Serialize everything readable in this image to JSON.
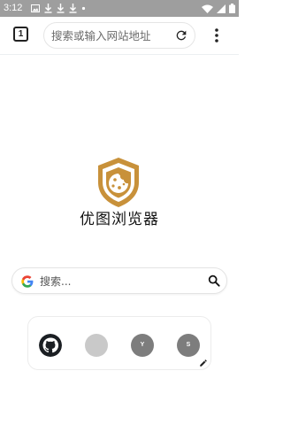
{
  "status_bar": {
    "time": "3:12",
    "left_icons": [
      "image-icon",
      "download-icon",
      "download-icon",
      "download-icon",
      "dot-icon"
    ],
    "right_icons": [
      "wifi-icon",
      "signal-icon",
      "battery-icon"
    ]
  },
  "toolbar": {
    "tab_count": "1",
    "address_placeholder": "搜索或输入网站地址",
    "reload_icon": "reload-icon",
    "menu_icon": "more-vert-icon"
  },
  "brand": {
    "app_name": "优图浏览器",
    "logo_icon": "shield-cookie-icon",
    "logo_color": "#c8913a"
  },
  "search": {
    "placeholder": "搜索...",
    "engine_icon": "google-g-icon",
    "search_icon": "search-icon"
  },
  "shortcuts": {
    "tiles": [
      {
        "icon": "github-icon",
        "letter": ""
      },
      {
        "icon": "blank-tile",
        "letter": ""
      },
      {
        "icon": "letter-tile",
        "letter": "Y"
      },
      {
        "icon": "letter-tile",
        "letter": "S"
      }
    ],
    "edit_icon": "edit-pencil-icon"
  }
}
